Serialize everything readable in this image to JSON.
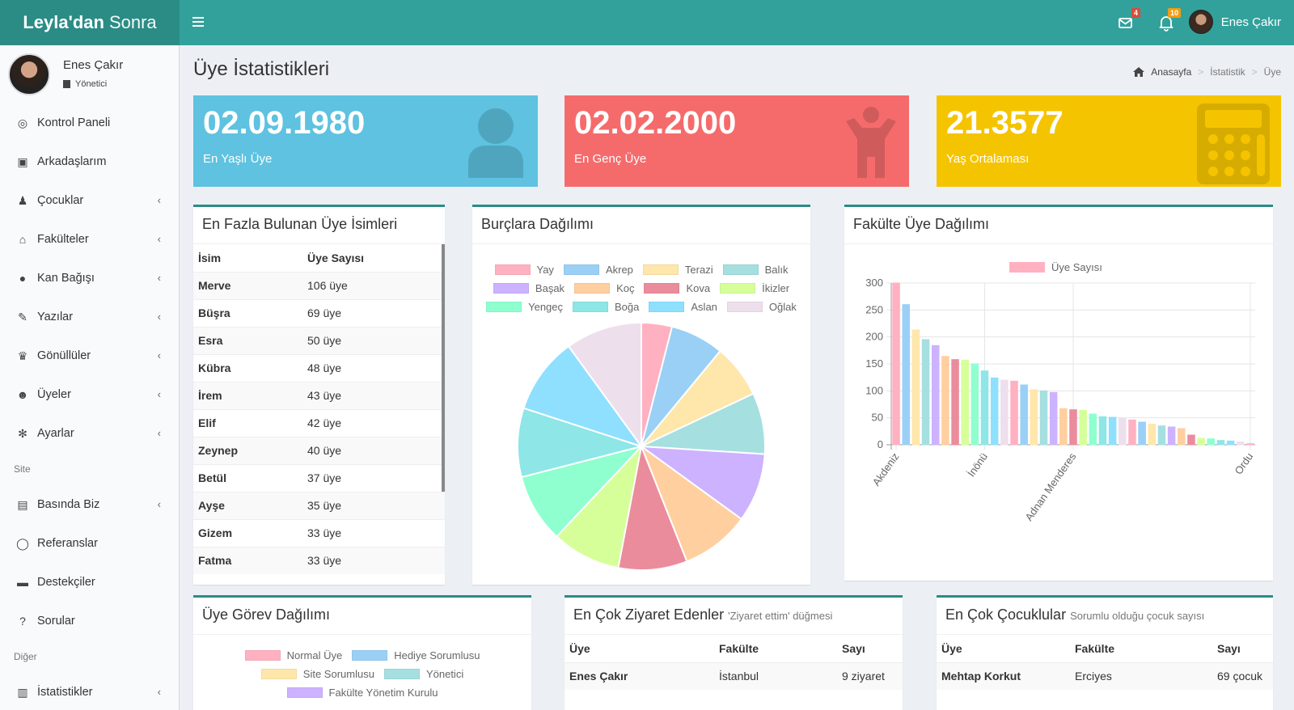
{
  "brand": {
    "bold": "Leyla'dan",
    "light": "Sonra"
  },
  "header": {
    "messages_count": "4",
    "notifications_count": "10",
    "user_name": "Enes Çakır"
  },
  "sidebar": {
    "user_name": "Enes Çakır",
    "user_role": "Yönetici",
    "items": [
      {
        "label": "Kontrol Paneli",
        "icon": "dashboard-icon",
        "chevron": false
      },
      {
        "label": "Arkadaşlarım",
        "icon": "address-book-icon",
        "chevron": false
      },
      {
        "label": "Çocuklar",
        "icon": "child-icon",
        "chevron": true
      },
      {
        "label": "Fakülteler",
        "icon": "university-icon",
        "chevron": true
      },
      {
        "label": "Kan Bağışı",
        "icon": "drop-icon",
        "chevron": true
      },
      {
        "label": "Yazılar",
        "icon": "pencil-icon",
        "chevron": true
      },
      {
        "label": "Gönüllüler",
        "icon": "trophy-icon",
        "chevron": true
      },
      {
        "label": "Üyeler",
        "icon": "users-icon",
        "chevron": true
      },
      {
        "label": "Ayarlar",
        "icon": "gear-icon",
        "chevron": true
      }
    ],
    "section_site": "Site",
    "site_items": [
      {
        "label": "Basında Biz",
        "icon": "newspaper-icon",
        "chevron": true
      },
      {
        "label": "Referanslar",
        "icon": "comment-icon",
        "chevron": false
      },
      {
        "label": "Destekçiler",
        "icon": "briefcase-icon",
        "chevron": false
      },
      {
        "label": "Sorular",
        "icon": "question-icon",
        "chevron": false
      }
    ],
    "section_other": "Diğer",
    "other_items": [
      {
        "label": "İstatistikler",
        "icon": "bar-chart-icon",
        "chevron": true
      }
    ]
  },
  "page": {
    "title": "Üye İstatistikleri",
    "breadcrumb": [
      "Anasayfa",
      "İstatistik",
      "Üye"
    ]
  },
  "stats": [
    {
      "value": "02.09.1980",
      "label": "En Yaşlı Üye",
      "color": "#5ec2e0"
    },
    {
      "value": "02.02.2000",
      "label": "En Genç Üye",
      "color": "#f56b6b"
    },
    {
      "value": "21.3577",
      "label": "Yaş Ortalaması",
      "color": "#f5c400"
    }
  ],
  "names_box": {
    "title": "En Fazla Bulunan Üye İsimleri",
    "headers": [
      "İsim",
      "Üye Sayısı"
    ],
    "rows": [
      [
        "Merve",
        "106 üye"
      ],
      [
        "Büşra",
        "69 üye"
      ],
      [
        "Esra",
        "50 üye"
      ],
      [
        "Kübra",
        "48 üye"
      ],
      [
        "İrem",
        "43 üye"
      ],
      [
        "Elif",
        "42 üye"
      ],
      [
        "Zeynep",
        "40 üye"
      ],
      [
        "Betül",
        "37 üye"
      ],
      [
        "Ayşe",
        "35 üye"
      ],
      [
        "Gizem",
        "33 üye"
      ],
      [
        "Fatma",
        "33 üye"
      ]
    ]
  },
  "zodiac_box": {
    "title": "Burçlara Dağılımı"
  },
  "faculty_box": {
    "title": "Fakülte Üye Dağılımı"
  },
  "role_box": {
    "title": "Üye Görev Dağılımı"
  },
  "visits_box": {
    "title": "En Çok Ziyaret Edenler",
    "subtitle": "'Ziyaret ettim' düğmesi",
    "headers": [
      "Üye",
      "Fakülte",
      "Sayı"
    ],
    "rows": [
      [
        "Enes Çakır",
        "İstanbul",
        "9 ziyaret"
      ]
    ]
  },
  "children_box": {
    "title": "En Çok Çocuklular",
    "subtitle": "Sorumlu olduğu çocuk sayısı",
    "headers": [
      "Üye",
      "Fakülte",
      "Sayı"
    ],
    "rows": [
      [
        "Mehtap Korkut",
        "Erciyes",
        "69 çocuk"
      ]
    ]
  },
  "chart_data": [
    {
      "type": "pie",
      "title": "Burçlara Dağılımı",
      "labels": [
        "Yay",
        "Akrep",
        "Terazi",
        "Balık",
        "Başak",
        "Koç",
        "Kova",
        "İkizler",
        "Yengeç",
        "Boğa",
        "Aslan",
        "Oğlak"
      ],
      "values": [
        4,
        7,
        7,
        8,
        9,
        9,
        9,
        9,
        9,
        9,
        10,
        10
      ],
      "colors": [
        "#ffb1c1",
        "#9ad0f5",
        "#ffe6aa",
        "#a5dfdf",
        "#ccb2ff",
        "#ffcf9f",
        "#ea8c9c",
        "#d6ff9a",
        "#8fffcf",
        "#8ee6e6",
        "#8fdfff",
        "#eedfec"
      ],
      "legend": "top"
    },
    {
      "type": "bar",
      "title": "Fakülte Üye Dağılımı",
      "series": [
        {
          "name": "Üye Sayısı",
          "values": [
            300,
            260,
            213,
            195,
            184,
            164,
            158,
            157,
            150,
            137,
            124,
            120,
            118,
            111,
            102,
            100,
            97,
            67,
            65,
            64,
            57,
            52,
            51,
            49,
            46,
            42,
            38,
            35,
            33,
            30,
            18,
            12,
            11,
            8,
            7,
            5,
            2
          ]
        }
      ],
      "category_tick_labels": {
        "0": "Akdeniz",
        "9": "İnönü",
        "18": "Adnan Menderes",
        "36": "Ordu"
      },
      "ylim": [
        0,
        300
      ],
      "yticks": [
        0,
        50,
        100,
        150,
        200,
        250,
        300
      ],
      "colors": [
        "#ffb1c1",
        "#9ad0f5",
        "#ffe6aa",
        "#a5dfdf",
        "#ccb2ff",
        "#ffcf9f",
        "#ea8c9c",
        "#d6ff9a",
        "#8fffcf",
        "#8ee6e6",
        "#8fdfff",
        "#eedfec"
      ],
      "legend": "top",
      "grid": true
    },
    {
      "type": "pie",
      "title": "Üye Görev Dağılımı",
      "labels": [
        "Normal Üye",
        "Hediye Sorumlusu",
        "Site Sorumlusu",
        "Yönetici",
        "Fakülte Yönetim Kurulu"
      ],
      "colors": [
        "#ffb1c1",
        "#9ad0f5",
        "#ffe6aa",
        "#a5dfdf",
        "#ccb2ff"
      ],
      "legend": "top"
    }
  ]
}
